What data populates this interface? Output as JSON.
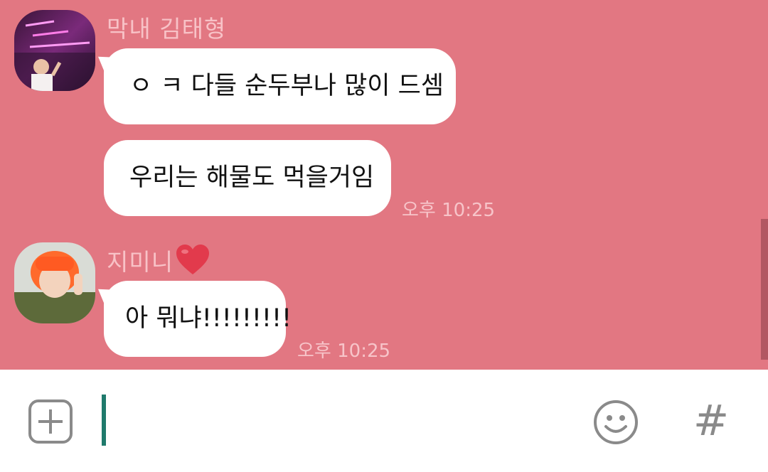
{
  "colors": {
    "chat_background": "#e27782",
    "bubble": "#ffffff",
    "sender_name": "#f8c2c7",
    "timestamp": "#f7c4c9",
    "cursor": "#1f7a6c",
    "icon_gray": "#8a8a8a",
    "heart": "#e23a4c"
  },
  "messages": [
    {
      "sender": "막내 김태형",
      "avatar_icon": "neon-sign-avatar",
      "bubbles": [
        "ㅇ ㅋ 다들 순두부나 많이 드셈",
        "우리는 해물도 먹을거임"
      ],
      "time": "오후 10:25"
    },
    {
      "sender": "지미니",
      "sender_icon": "heart-icon",
      "avatar_icon": "orange-hair-avatar",
      "bubbles": [
        "아 뭐냐!!!!!!!!!"
      ],
      "time": "오후 10:25"
    }
  ],
  "input_bar": {
    "plus_icon": "plus-box-icon",
    "emoji_icon": "smiley-icon",
    "hash_label": "#"
  }
}
